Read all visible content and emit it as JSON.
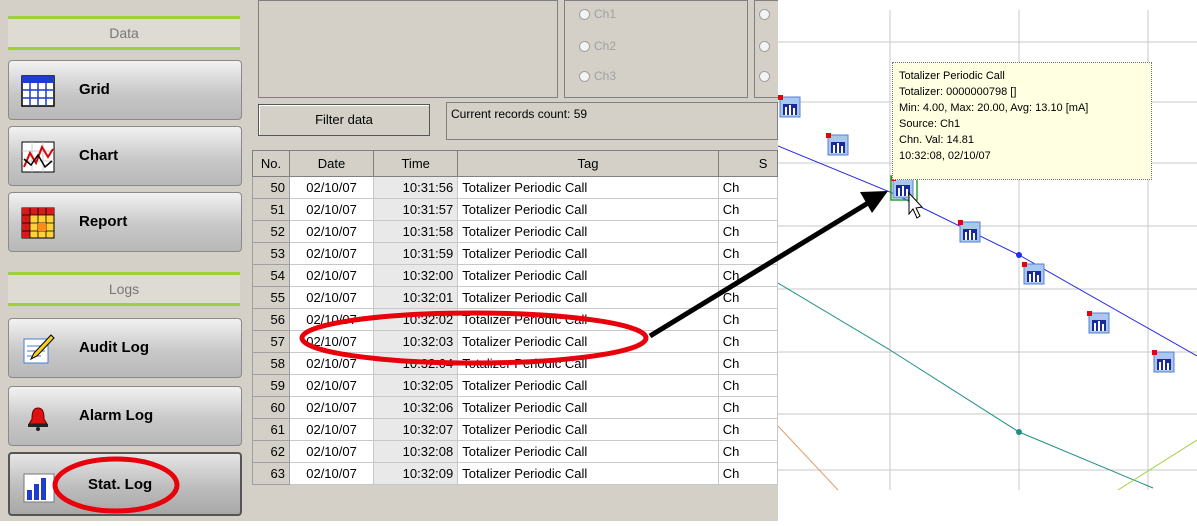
{
  "sidebar": {
    "data_header": "Data",
    "logs_header": "Logs",
    "items": [
      {
        "label": "Grid",
        "icon": "grid-icon"
      },
      {
        "label": "Chart",
        "icon": "chart-icon"
      },
      {
        "label": "Report",
        "icon": "report-icon"
      },
      {
        "label": "Audit Log",
        "icon": "pencil-icon"
      },
      {
        "label": "Alarm Log",
        "icon": "bell-icon"
      },
      {
        "label": "Stat. Log",
        "icon": "bar-chart-icon"
      }
    ]
  },
  "filter": {
    "channels": [
      "Ch1",
      "Ch2",
      "Ch3"
    ],
    "button_label": "Filter data",
    "records_text": "Current records count: 59"
  },
  "table": {
    "headers": [
      "No.",
      "Date",
      "Time",
      "Tag",
      "S"
    ],
    "rows": [
      {
        "no": "50",
        "date": "02/10/07",
        "time": "10:31:56",
        "tag": "Totalizer Periodic Call",
        "s": "Ch"
      },
      {
        "no": "51",
        "date": "02/10/07",
        "time": "10:31:57",
        "tag": "Totalizer Periodic Call",
        "s": "Ch"
      },
      {
        "no": "52",
        "date": "02/10/07",
        "time": "10:31:58",
        "tag": "Totalizer Periodic Call",
        "s": "Ch"
      },
      {
        "no": "53",
        "date": "02/10/07",
        "time": "10:31:59",
        "tag": "Totalizer Periodic Call",
        "s": "Ch"
      },
      {
        "no": "54",
        "date": "02/10/07",
        "time": "10:32:00",
        "tag": "Totalizer Periodic Call",
        "s": "Ch"
      },
      {
        "no": "55",
        "date": "02/10/07",
        "time": "10:32:01",
        "tag": "Totalizer Periodic Call",
        "s": "Ch"
      },
      {
        "no": "56",
        "date": "02/10/07",
        "time": "10:32:02",
        "tag": "Totalizer Periodic Call",
        "s": "Ch"
      },
      {
        "no": "57",
        "date": "02/10/07",
        "time": "10:32:03",
        "tag": "Totalizer Periodic Call",
        "s": "Ch"
      },
      {
        "no": "58",
        "date": "02/10/07",
        "time": "10:32:04",
        "tag": "Totalizer Periodic Call",
        "s": "Ch"
      },
      {
        "no": "59",
        "date": "02/10/07",
        "time": "10:32:05",
        "tag": "Totalizer Periodic Call",
        "s": "Ch"
      },
      {
        "no": "60",
        "date": "02/10/07",
        "time": "10:32:06",
        "tag": "Totalizer Periodic Call",
        "s": "Ch"
      },
      {
        "no": "61",
        "date": "02/10/07",
        "time": "10:32:07",
        "tag": "Totalizer Periodic Call",
        "s": "Ch"
      },
      {
        "no": "62",
        "date": "02/10/07",
        "time": "10:32:08",
        "tag": "Totalizer Periodic Call",
        "s": "Ch"
      },
      {
        "no": "63",
        "date": "02/10/07",
        "time": "10:32:09",
        "tag": "Totalizer Periodic Call",
        "s": "Ch"
      }
    ]
  },
  "tooltip": {
    "lines": [
      "Totalizer Periodic Call",
      "Totalizer: 0000000798 []",
      "Min: 4.00, Max: 20.00, Avg: 13.10 [mA]",
      "Source: Ch1",
      "Chn. Val: 14.81",
      "10:32:08, 02/10/07"
    ]
  },
  "colors": {
    "highlight": "#e8000a",
    "section_accent": "#9fcf3a",
    "series_1": "#2a2ae8",
    "series_2": "#1f8f85"
  }
}
